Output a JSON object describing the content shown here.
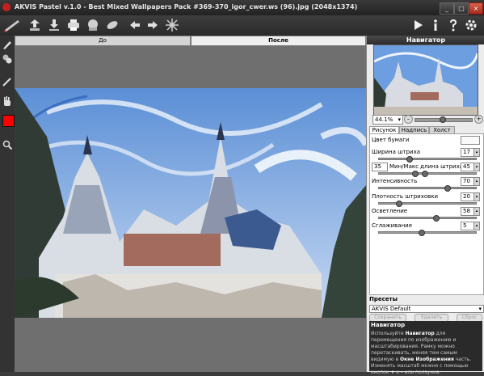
{
  "window": {
    "title": "AKVIS Pastel v.1.0 - Best Mixed Wallpapers Pack #369-370_igor_cwer.ws (96).jpg (2048x1374)",
    "controls": [
      "_",
      "□",
      "×"
    ]
  },
  "canvas_tabs": {
    "before": "До",
    "after": "После"
  },
  "navigator": {
    "header": "Навигатор",
    "zoom": "44.1%",
    "zoom_options_arrow": "▾",
    "zoom_out": "–",
    "zoom_in": "+",
    "slider_level": 0.5
  },
  "settings_tabs": [
    "Рисунок",
    "Надпись",
    "Холст"
  ],
  "settings": {
    "paper_color_label": "Цвет бумаги",
    "paper_color": "#fafafa",
    "stroke_width": {
      "label": "Ширина штриха",
      "value": "17"
    },
    "min_max_length": {
      "label": "Мин/Макс длина штриха",
      "min": "35",
      "max": "45"
    },
    "intensity": {
      "label": "Интенсивность",
      "value": "70"
    },
    "hatch_density": {
      "label": "Плотность штриховки",
      "value": "20"
    },
    "lighten": {
      "label": "Осветление",
      "value": "58"
    },
    "smoothing": {
      "label": "Сглаживание",
      "value": "5"
    }
  },
  "presets": {
    "header": "Пресеты",
    "selected": "AKVIS Default",
    "save_label": "Сохранить",
    "delete_label": "Удалить",
    "reset_label": "Сброс"
  },
  "help": {
    "title": "Навигатор",
    "text_1": "Используйте ",
    "text_bold_1": "Навигатор",
    "text_2": " для перемещения по изображению и масштабирования. Рамку можно перетаскивать, меняя тем самым видимую в ",
    "text_bold_2": "Окне Изображения",
    "text_3": " часть. Изменять масштаб можно с помощью кнопок ",
    "text_bold_3": "+",
    "text_4": " и ",
    "text_bold_4": "-",
    "text_5": " или ползунка."
  },
  "colors": {
    "accent": "#ff0000",
    "panel_bg": "#ececec",
    "dark_bg": "#3c3c3c"
  },
  "icons": {
    "toolbar": [
      "app-logo-icon",
      "open-icon",
      "save-icon",
      "print-icon",
      "export-icon",
      "batch-icon",
      "undo-icon",
      "redo-icon",
      "settings-burst-icon",
      "run-icon",
      "info-icon",
      "help-icon",
      "preferences-icon"
    ],
    "tools": [
      "brush-icon",
      "stamp-icon",
      "pencil-icon",
      "hand-icon",
      "zoom-icon"
    ]
  }
}
